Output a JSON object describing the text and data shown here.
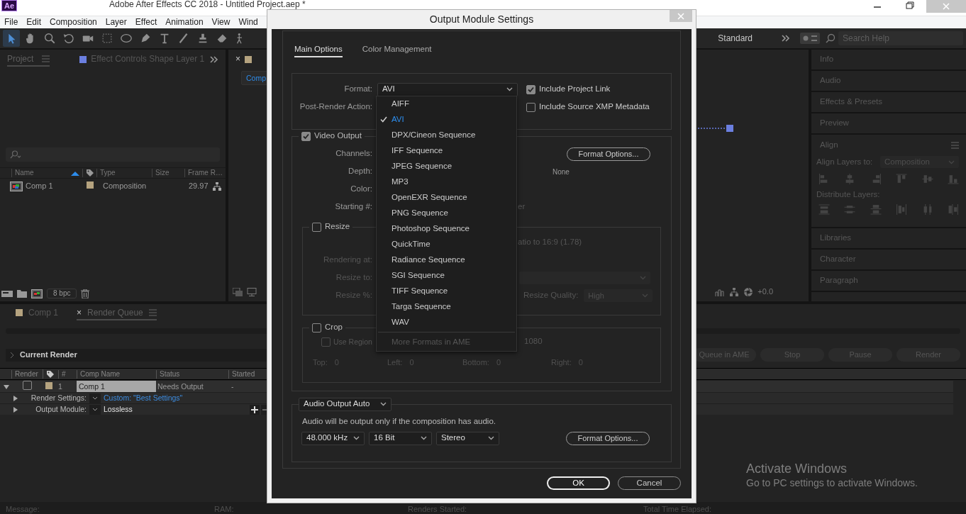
{
  "app": {
    "logo": "Ae",
    "title": "Adobe After Effects CC 2018 - Untitled Project.aep *"
  },
  "menu": [
    "File",
    "Edit",
    "Composition",
    "Layer",
    "Effect",
    "Animation",
    "View",
    "Wind"
  ],
  "tools": [
    {
      "kind": "selection",
      "selected": true
    },
    {
      "kind": "hand",
      "selected": false
    },
    {
      "kind": "zoom",
      "selected": false
    },
    {
      "kind": "rotate",
      "selected": false
    },
    {
      "kind": "camera",
      "selected": false
    },
    {
      "kind": "pan",
      "selected": false
    },
    {
      "kind": "ellipse",
      "selected": false
    },
    {
      "kind": "pen",
      "selected": false
    },
    {
      "kind": "type",
      "selected": false
    },
    {
      "kind": "brush",
      "selected": false
    },
    {
      "kind": "stamp",
      "selected": false
    },
    {
      "kind": "eraser",
      "selected": false
    },
    {
      "kind": "puppet",
      "selected": false
    }
  ],
  "workspace": "Standard",
  "search_help": {
    "placeholder": "Search Help"
  },
  "project_panel": {
    "tabs": [
      {
        "label": "Project",
        "selected": true
      },
      {
        "label": "Effect Controls Shape Layer 1",
        "selected": false,
        "color": "#6b7fe0"
      }
    ],
    "columns": [
      "Name",
      "Type",
      "Size",
      "Frame R…"
    ],
    "rows": [
      {
        "name": "Comp 1",
        "color": "#b5a37f",
        "type": "Composition",
        "frame_rate": "29.97"
      }
    ],
    "bit_depth": "8 bpc"
  },
  "comp_panel": {
    "tab_close": "×",
    "view_button": "Comp",
    "exposure": "+0.0"
  },
  "right_panels": [
    {
      "title": "Info",
      "kind": "collapsed"
    },
    {
      "title": "Audio",
      "kind": "collapsed"
    },
    {
      "title": "Effects & Presets",
      "kind": "collapsed"
    },
    {
      "title": "Preview",
      "kind": "collapsed"
    },
    {
      "title": "Align",
      "kind": "align",
      "align_label": "Align Layers to:",
      "align_to": "Composition",
      "distribute_label": "Distribute Layers:"
    },
    {
      "title": "Libraries",
      "kind": "collapsed"
    },
    {
      "title": "Character",
      "kind": "collapsed"
    },
    {
      "title": "Paragraph",
      "kind": "collapsed"
    }
  ],
  "render_queue": {
    "tabs": [
      {
        "label": "Comp 1",
        "selected": false,
        "color": "#b5a37f"
      },
      {
        "label": "Render Queue",
        "selected": true,
        "close": "×"
      }
    ],
    "current_render": "Current Render",
    "buttons": [
      "Queue in AME",
      "Stop",
      "Pause",
      "Render"
    ],
    "columns": [
      "Render",
      "#",
      "Comp Name",
      "Status",
      "Started"
    ],
    "items": [
      {
        "expanded": true,
        "render": false,
        "color": "#b5a37f",
        "number": "1",
        "comp_name": "Comp 1",
        "status": "Needs Output",
        "started": "-",
        "settings": [
          {
            "kind": "settings",
            "expanded": false,
            "label": "Render Settings:",
            "value": "Custom: \"Best Settings\""
          },
          {
            "kind": "module",
            "expanded": false,
            "label": "Output Module:",
            "value": "Lossless"
          }
        ]
      }
    ]
  },
  "status_bar": [
    "Message:",
    "RAM:",
    "Renders Started:",
    "Total Time Elapsed:"
  ],
  "dialog": {
    "title": "Output Module Settings",
    "tabs": [
      {
        "label": "Main Options",
        "selected": true
      },
      {
        "label": "Color Management",
        "selected": false
      }
    ],
    "format_label": "Format:",
    "format": "AVI",
    "post_render_label": "Post-Render Action:",
    "options": [
      {
        "label": "Include Project Link",
        "checked": true
      },
      {
        "label": "Include Source XMP Metadata",
        "checked": false
      }
    ],
    "video": {
      "label": "Video Output",
      "checked": true,
      "fields": [
        {
          "label": "Channels:",
          "kind": "button",
          "extra": "Format Options..."
        },
        {
          "label": "Depth:",
          "kind": "note",
          "extra": "None"
        },
        {
          "label": "Color:",
          "kind": "none"
        },
        {
          "label": "Starting #:",
          "kind": "dim",
          "extra": "er"
        }
      ]
    },
    "resize": {
      "label": "Resize",
      "checked": false,
      "aspect": "atio to 16:9 (1.78)",
      "rendering_label": "Rendering at:",
      "resize_to_label": "Resize to:",
      "percent_label": "Resize %:",
      "quality_label": "Resize Quality:",
      "quality": "High"
    },
    "crop": {
      "label": "Crop",
      "checked": false,
      "region_label": "Use Region",
      "region_checked": false,
      "size": "1080",
      "edges": [
        {
          "label": "Top:",
          "value": "0"
        },
        {
          "label": "Left:",
          "value": "0"
        },
        {
          "label": "Bottom:",
          "value": "0"
        },
        {
          "label": "Right:",
          "value": "0"
        }
      ]
    },
    "audio": {
      "mode": "Audio Output Auto",
      "note": "Audio will be output only if the composition has audio.",
      "rate": "48.000 kHz",
      "depth": "16 Bit",
      "channels": "Stereo",
      "button": "Format Options..."
    },
    "buttons": [
      {
        "label": "OK",
        "default": true
      },
      {
        "label": "Cancel",
        "default": false
      }
    ]
  },
  "format_menu": {
    "items": [
      {
        "label": "AIFF",
        "selected": false
      },
      {
        "label": "AVI",
        "selected": true
      },
      {
        "label": "DPX/Cineon Sequence",
        "selected": false
      },
      {
        "label": "IFF Sequence",
        "selected": false
      },
      {
        "label": "JPEG Sequence",
        "selected": false
      },
      {
        "label": "MP3",
        "selected": false
      },
      {
        "label": "OpenEXR Sequence",
        "selected": false
      },
      {
        "label": "PNG Sequence",
        "selected": false
      },
      {
        "label": "Photoshop Sequence",
        "selected": false
      },
      {
        "label": "QuickTime",
        "selected": false
      },
      {
        "label": "Radiance Sequence",
        "selected": false
      },
      {
        "label": "SGI Sequence",
        "selected": false
      },
      {
        "label": "TIFF Sequence",
        "selected": false
      },
      {
        "label": "Targa Sequence",
        "selected": false
      },
      {
        "label": "WAV",
        "selected": false
      }
    ],
    "more": "More Formats in AME"
  },
  "activation": {
    "title": "Activate Windows",
    "text": "Go to PC settings to activate Windows."
  }
}
